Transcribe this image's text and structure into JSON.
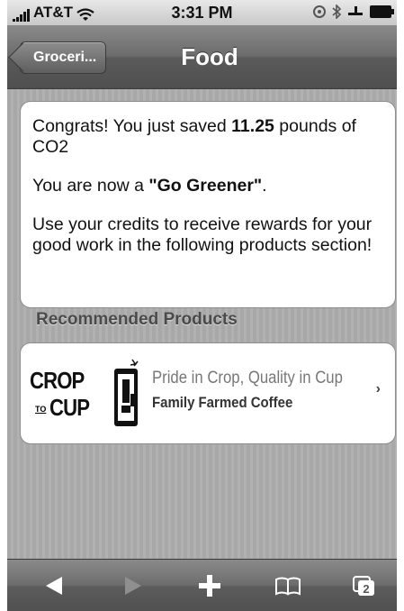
{
  "status_bar": {
    "carrier": "AT&T",
    "time": "3:31 PM"
  },
  "nav": {
    "back_label": "Groceri...",
    "title": "Food"
  },
  "message": {
    "line1_prefix": "Congrats! You just saved ",
    "saved_amount": "11.25",
    "line1_suffix": " pounds of CO2",
    "line2_prefix": "You are now a ",
    "status_level": "\"Go Greener\"",
    "line2_suffix": ".",
    "line3": "Use your credits to receive rewards for your good work in the following products section!"
  },
  "recommended": {
    "header": "Recommended Products",
    "products": [
      {
        "logo_text_top": "CROP",
        "logo_text_mid": "TO",
        "logo_text_bottom": "CUP",
        "title": "Pride in Crop, Quality in Cup",
        "subtitle": "Family Farmed Coffee"
      }
    ]
  },
  "toolbar": {
    "tab_count": "2",
    "icons": [
      "back-arrow-icon",
      "forward-arrow-icon",
      "add-icon",
      "bookmarks-icon",
      "tabs-icon"
    ]
  }
}
